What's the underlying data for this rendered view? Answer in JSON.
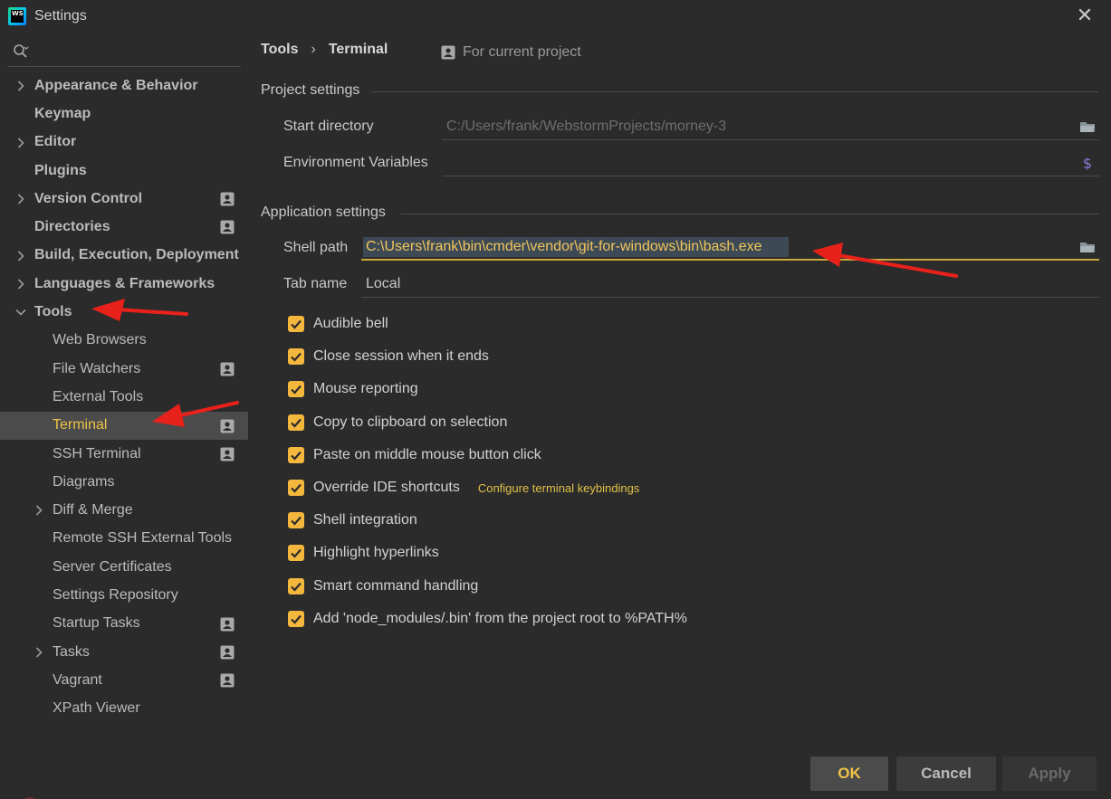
{
  "window": {
    "title": "Settings"
  },
  "search": {
    "value": "",
    "placeholder": ""
  },
  "sidebar": {
    "items": [
      {
        "label": "Appearance & Behavior",
        "level": 0,
        "expandable": true,
        "expanded": false,
        "project": false,
        "selected": false
      },
      {
        "label": "Keymap",
        "level": 0,
        "expandable": false,
        "project": false,
        "selected": false
      },
      {
        "label": "Editor",
        "level": 0,
        "expandable": true,
        "expanded": false,
        "project": false,
        "selected": false
      },
      {
        "label": "Plugins",
        "level": 0,
        "expandable": false,
        "project": false,
        "selected": false
      },
      {
        "label": "Version Control",
        "level": 0,
        "expandable": true,
        "expanded": false,
        "project": true,
        "selected": false
      },
      {
        "label": "Directories",
        "level": 0,
        "expandable": false,
        "project": true,
        "selected": false
      },
      {
        "label": "Build, Execution, Deployment",
        "level": 0,
        "expandable": true,
        "expanded": false,
        "project": false,
        "selected": false
      },
      {
        "label": "Languages & Frameworks",
        "level": 0,
        "expandable": true,
        "expanded": false,
        "project": false,
        "selected": false
      },
      {
        "label": "Tools",
        "level": 0,
        "expandable": true,
        "expanded": true,
        "project": false,
        "selected": false
      },
      {
        "label": "Web Browsers",
        "level": 1,
        "expandable": false,
        "project": false,
        "selected": false
      },
      {
        "label": "File Watchers",
        "level": 1,
        "expandable": false,
        "project": true,
        "selected": false
      },
      {
        "label": "External Tools",
        "level": 1,
        "expandable": false,
        "project": false,
        "selected": false
      },
      {
        "label": "Terminal",
        "level": 1,
        "expandable": false,
        "project": true,
        "selected": true
      },
      {
        "label": "SSH Terminal",
        "level": 1,
        "expandable": false,
        "project": true,
        "selected": false
      },
      {
        "label": "Diagrams",
        "level": 1,
        "expandable": false,
        "project": false,
        "selected": false
      },
      {
        "label": "Diff & Merge",
        "level": 1,
        "expandable": true,
        "expanded": false,
        "project": false,
        "selected": false
      },
      {
        "label": "Remote SSH External Tools",
        "level": 1,
        "expandable": false,
        "project": false,
        "selected": false
      },
      {
        "label": "Server Certificates",
        "level": 1,
        "expandable": false,
        "project": false,
        "selected": false
      },
      {
        "label": "Settings Repository",
        "level": 1,
        "expandable": false,
        "project": false,
        "selected": false
      },
      {
        "label": "Startup Tasks",
        "level": 1,
        "expandable": false,
        "project": true,
        "selected": false
      },
      {
        "label": "Tasks",
        "level": 1,
        "expandable": true,
        "expanded": false,
        "project": true,
        "selected": false
      },
      {
        "label": "Vagrant",
        "level": 1,
        "expandable": false,
        "project": true,
        "selected": false
      },
      {
        "label": "XPath Viewer",
        "level": 1,
        "expandable": false,
        "project": false,
        "selected": false
      }
    ]
  },
  "breadcrumb": {
    "parent": "Tools",
    "separator": "›",
    "current": "Terminal"
  },
  "scope": {
    "label": "For current project"
  },
  "project_settings": {
    "title": "Project settings",
    "start_directory": {
      "label": "Start directory",
      "value": "C:/Users/frank/WebstormProjects/morney-3"
    },
    "env_vars": {
      "label": "Environment Variables",
      "value": ""
    }
  },
  "app_settings": {
    "title": "Application settings",
    "shell_path": {
      "label": "Shell path",
      "value": "C:\\Users\\frank\\bin\\cmder\\vendor\\git-for-windows\\bin\\bash.exe"
    },
    "tab_name": {
      "label": "Tab name",
      "value": "Local"
    },
    "options": [
      {
        "label": "Audible bell",
        "checked": true
      },
      {
        "label": "Close session when it ends",
        "checked": true
      },
      {
        "label": "Mouse reporting",
        "checked": true
      },
      {
        "label": "Copy to clipboard on selection",
        "checked": true
      },
      {
        "label": "Paste on middle mouse button click",
        "checked": true
      },
      {
        "label": "Override IDE shortcuts",
        "checked": true,
        "link": "Configure terminal keybindings"
      },
      {
        "label": "Shell integration",
        "checked": true
      },
      {
        "label": "Highlight hyperlinks",
        "checked": true
      },
      {
        "label": "Smart command handling",
        "checked": true
      },
      {
        "label": "Add 'node_modules/.bin' from the project root to %PATH%",
        "checked": true
      }
    ]
  },
  "buttons": {
    "ok": "OK",
    "cancel": "Cancel",
    "apply": "Apply"
  },
  "colors": {
    "accent": "#f4b73e",
    "background": "#2b2b2b",
    "selection": "#4b4b4b",
    "annotation_arrow": "#e8211b"
  }
}
